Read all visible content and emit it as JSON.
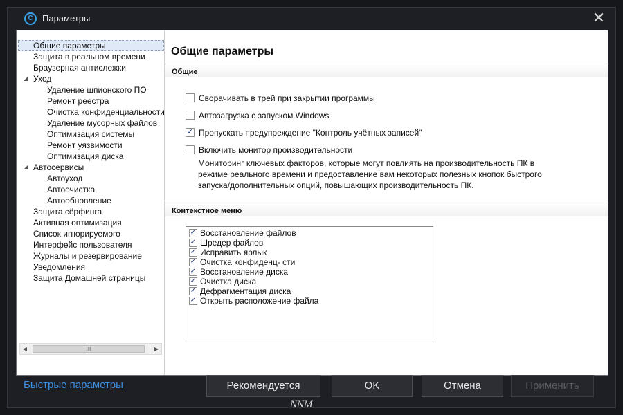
{
  "window": {
    "title": "Параметры",
    "app_icon": "C"
  },
  "sidebar": {
    "items": [
      {
        "label": "Общие параметры"
      },
      {
        "label": "Защита в реальном времени"
      },
      {
        "label": "Браузерная антислежки"
      },
      {
        "label": "Уход"
      },
      {
        "label": "Удаление шпионского ПО"
      },
      {
        "label": "Ремонт реестра"
      },
      {
        "label": "Очистка конфиденциальности"
      },
      {
        "label": "Удаление мусорных файлов"
      },
      {
        "label": "Оптимизация системы"
      },
      {
        "label": "Ремонт уязвимости"
      },
      {
        "label": "Оптимизация диска"
      },
      {
        "label": "Автосервисы"
      },
      {
        "label": "Автоуход"
      },
      {
        "label": "Автоочистка"
      },
      {
        "label": "Автообновление"
      },
      {
        "label": "Защита сёрфинга"
      },
      {
        "label": "Активная оптимизация"
      },
      {
        "label": "Список игнорируемого"
      },
      {
        "label": "Интерфейс пользователя"
      },
      {
        "label": "Журналы и резервирование"
      },
      {
        "label": "Уведомления"
      },
      {
        "label": "Защита Домашней страницы"
      }
    ],
    "scroll_thumb_glyph": "III"
  },
  "main": {
    "title": "Общие параметры",
    "general": {
      "header": "Общие",
      "options": [
        {
          "label": "Сворачивать в трей при закрытии программы",
          "checked": false
        },
        {
          "label": "Автозагрузка с запуском Windows",
          "checked": false
        },
        {
          "label": "Пропускать предупреждение \"Контроль учётных записей\"",
          "checked": true
        },
        {
          "label": "Включить монитор производительности",
          "checked": false
        }
      ],
      "description": "Мониторинг ключевых факторов, которые могут повлиять на производительность ПК в режиме реального времени и предоставление вам некоторых полезных кнопок быстрого запуска/дополнительных опций, повышающих производительность ПК."
    },
    "context": {
      "header": "Контекстное меню",
      "items": [
        {
          "label": "Восстановление файлов",
          "checked": true
        },
        {
          "label": "Шредер файлов",
          "checked": true
        },
        {
          "label": "Исправить ярлык",
          "checked": true
        },
        {
          "label": "Очистка конфиденц- сти",
          "checked": true
        },
        {
          "label": "Восстановление диска",
          "checked": true
        },
        {
          "label": "Очистка диска",
          "checked": true
        },
        {
          "label": "Дефрагментация диска",
          "checked": true
        },
        {
          "label": "Открыть расположение файла",
          "checked": true
        }
      ]
    }
  },
  "footer": {
    "quick_link": "Быстрые параметры",
    "recommended": "Рекомендуется",
    "ok": "OK",
    "cancel": "Отмена",
    "apply": "Применить",
    "watermark": "NNM"
  },
  "colors": {
    "accent": "#3aa0e8",
    "link": "#3e8fe0",
    "chrome_bg": "#1e1f24",
    "selection_bg": "#dfe9f7"
  }
}
